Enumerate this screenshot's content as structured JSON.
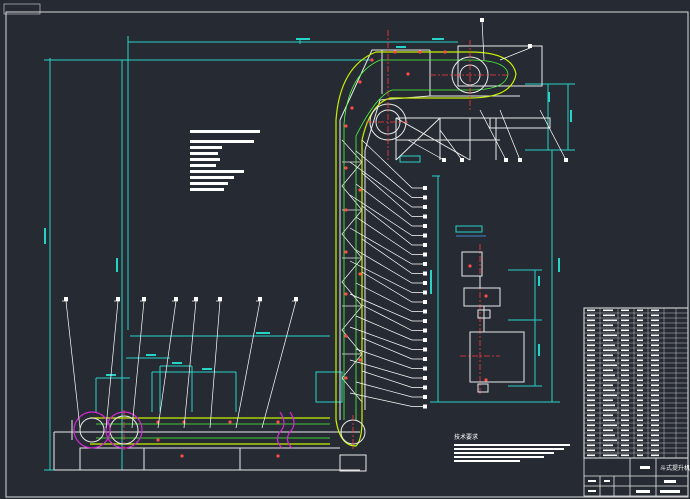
{
  "drawing": {
    "background": "#262b33",
    "frame_color": "#d8d8d8",
    "colors": {
      "structure": "#e8e8e8",
      "dimension": "#27d3c7",
      "leader": "#ffffff",
      "chain": "#c8f000",
      "chain_inner": "#4dff3a",
      "bucket_pins": "#ff4a4a",
      "center_line": "#ff3b3b",
      "purple_wheel": "#d427d4",
      "motor_blue": "#4da6ff",
      "note_text": "#ffffff"
    },
    "notes_title": "技术要求",
    "balloon_count_left_row": 8,
    "balloon_count_right_column": 24
  },
  "title_block": {
    "rows": 30,
    "cols": 6,
    "title": "斗式提升机"
  }
}
